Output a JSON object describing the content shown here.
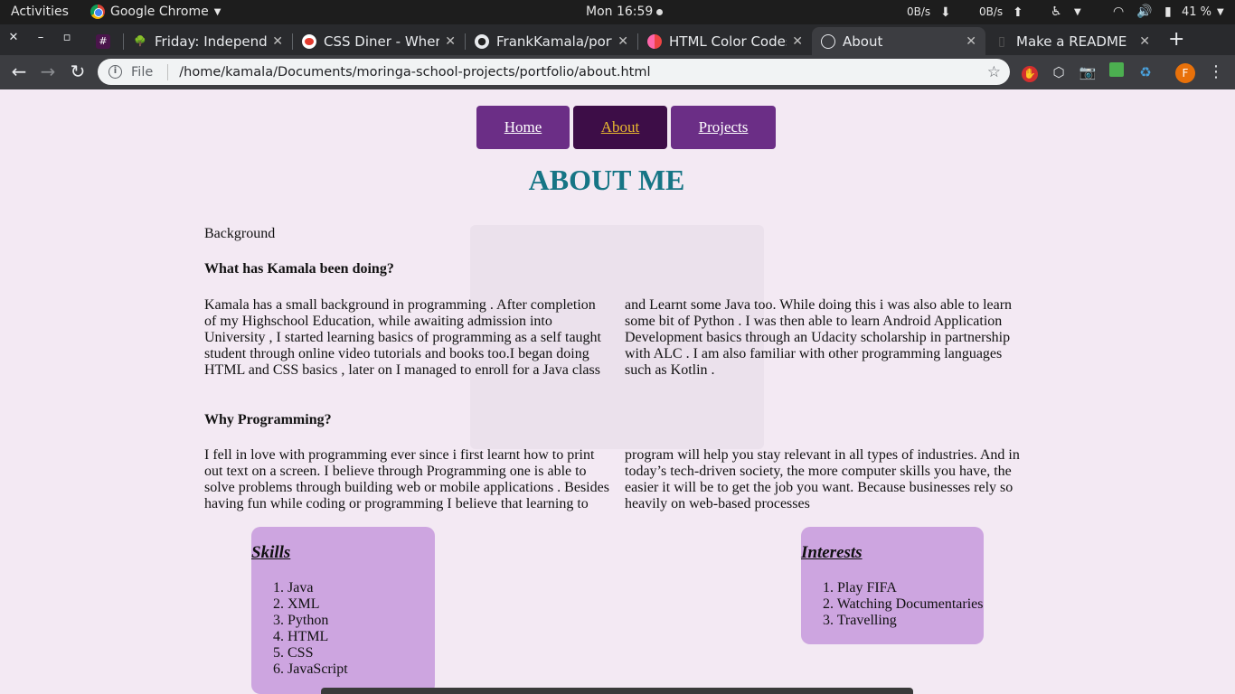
{
  "topbar": {
    "activities": "Activities",
    "app_name": "Google Chrome",
    "clock": "Mon 16:59",
    "net_down": "0B/s",
    "net_up": "0B/s",
    "battery": "41 %"
  },
  "tabs": [
    {
      "title": "Friday: Independence",
      "icon": "tree-icon",
      "active": false
    },
    {
      "title": "CSS Diner - Where we feast",
      "icon": "css-diner-icon",
      "active": false
    },
    {
      "title": "FrankKamala/portfolio",
      "icon": "github-icon",
      "active": false
    },
    {
      "title": "HTML Color Codes",
      "icon": "color-codes-icon",
      "active": false
    },
    {
      "title": "About",
      "icon": "globe-icon",
      "active": true
    },
    {
      "title": "Make a README",
      "icon": "document-icon",
      "active": false
    }
  ],
  "toolbar": {
    "file_label": "File",
    "url": "/home/kamala/Documents/moringa-school-projects/portfolio/about.html",
    "profile_initial": "F"
  },
  "page": {
    "nav": [
      "Home",
      "About",
      "Projects"
    ],
    "title": "ABOUT ME",
    "background_label": "Background",
    "q1_heading": "What has Kamala been doing?",
    "q1_col1": [
      "Kamala has a small background in programming . After completion",
      "of my Highschool Education, while awaiting admission into",
      "University , I started learning basics of programming as a self taught",
      "student through online video tutorials and books too.I began doing",
      "HTML and CSS basics , later on I managed to enroll for a Java class"
    ],
    "q1_col2": [
      "and Learnt some Java too. While doing this i was also able to learn",
      "some bit of Python . I was then able to learn Android Application",
      "Development basics through an Udacity scholarship in partnership",
      "with ALC . I am also familiar with other programming languages",
      "such as Kotlin ."
    ],
    "q2_heading": "Why Programming?",
    "q2_col1": [
      "I fell in love with programming ever since i first learnt how to print",
      "out text on a screen. I believe through Programming one is able to",
      "solve problems through building web or mobile applications . Besides",
      "having fun while coding or programming I believe that learning to"
    ],
    "q2_col2": [
      "program will help you stay relevant in all types of industries. And in",
      "today’s tech-driven society, the more computer skills you have, the",
      "easier it will be to get the job you want. Because businesses rely so",
      "heavily on web-based processes"
    ],
    "skills_title": "Skills",
    "skills": [
      "1. Java",
      "2. XML",
      "3. Python",
      "4. HTML",
      "5. CSS",
      "6. JavaScript"
    ],
    "interests_title": "Interests",
    "interests": [
      "1. Play FIFA",
      "2. Watching Documentaries",
      "3. Travelling"
    ]
  },
  "colors": {
    "nav_bg": "#6b2e86",
    "nav_active_bg": "#3d0d47",
    "nav_active_text": "#e8b830",
    "title": "#167585",
    "page_bg": "#f3e9f3",
    "box_bg": "#cda5e0"
  }
}
